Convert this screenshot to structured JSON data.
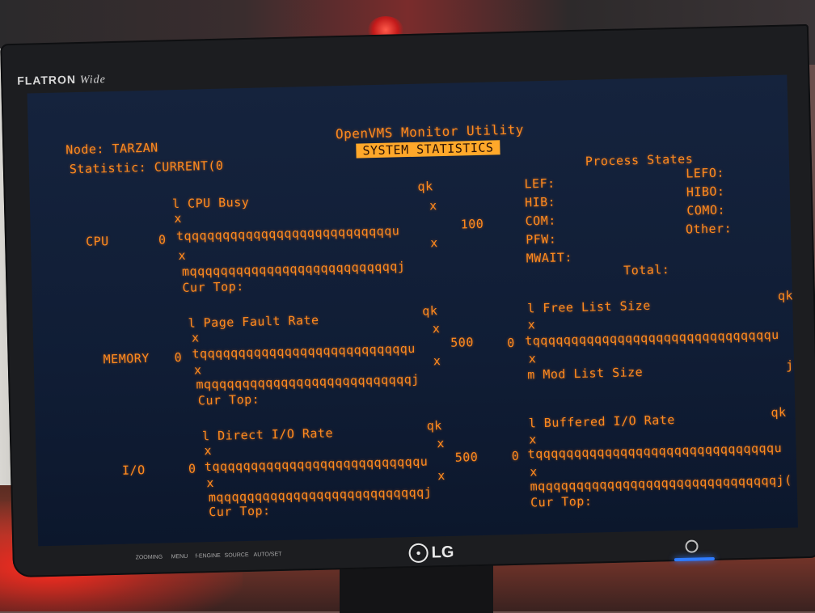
{
  "monitor": {
    "brand_label": "FLATRON",
    "brand_wide": "Wide",
    "maker_logo": "LG",
    "controls": [
      "ZOOMING",
      "MENU",
      "f-ENGINE",
      "SOURCE",
      "AUTO/SET"
    ]
  },
  "header": {
    "node": "Node: TARZAN",
    "statistic": "Statistic: CURRENT(0",
    "title": "OpenVMS Monitor Utility",
    "subtitle": "SYSTEM STATISTICS"
  },
  "process_states": {
    "title": "Process States",
    "left": [
      "LEF:",
      "HIB:",
      "COM:",
      "PFW:",
      "MWAIT:"
    ],
    "right": [
      "LEFO:",
      "HIBO:",
      "COMO:",
      "Other:"
    ],
    "total": "Total:"
  },
  "cpu": {
    "label": "CPU",
    "graph_title": "l CPU Busy",
    "corner": "qk",
    "x": "x",
    "zero": "0",
    "max": "100",
    "bar_top": "tqqqqqqqqqqqqqqqqqqqqqqqqqqqu",
    "bar_bottom": "mqqqqqqqqqqqqqqqqqqqqqqqqqqqj",
    "cur_top": "Cur Top:"
  },
  "memory": {
    "label": "MEMORY",
    "graph_title": "l Page Fault Rate",
    "corner": "qk",
    "x": "x",
    "zero": "0",
    "max": "500",
    "bar_top": "tqqqqqqqqqqqqqqqqqqqqqqqqqqqu",
    "bar_bottom": "mqqqqqqqqqqqqqqqqqqqqqqqqqqqj",
    "cur_top": "Cur Top:",
    "right_title": "l Free List Size",
    "right_corner": "qk",
    "right_zero": "0",
    "right_bar_top": "tqqqqqqqqqqqqqqqqqqqqqqqqqqqqqqqu",
    "right_mod": "m Mod List Size",
    "right_j": "j"
  },
  "io": {
    "label": "I/O",
    "graph_title": "l Direct I/O Rate",
    "corner": "qk",
    "x": "x",
    "zero": "0",
    "max": "500",
    "bar_top": "tqqqqqqqqqqqqqqqqqqqqqqqqqqqu",
    "bar_bottom": "mqqqqqqqqqqqqqqqqqqqqqqqqqqqj",
    "cur_top": "Cur Top:",
    "right_title": "l Buffered I/O Rate",
    "right_corner": "qk",
    "right_zero": "0",
    "right_bar_top": "tqqqqqqqqqqqqqqqqqqqqqqqqqqqqqqqu",
    "right_bar_bottom": "mqqqqqqqqqqqqqqqqqqqqqqqqqqqqqqqj(",
    "right_cur_top": "Cur Top:"
  }
}
